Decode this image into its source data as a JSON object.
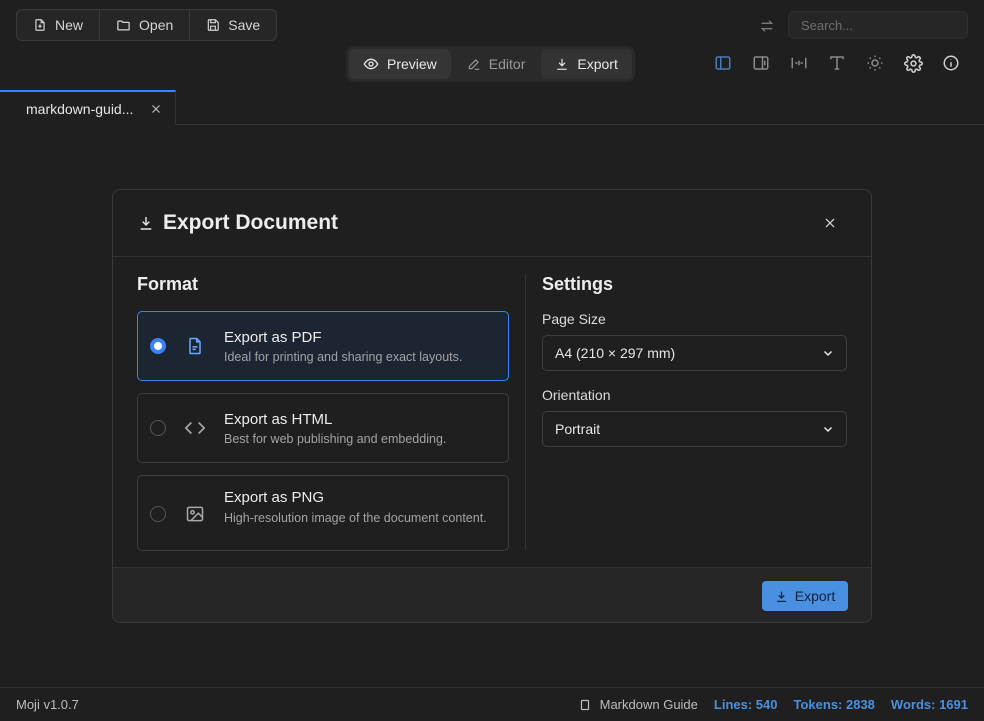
{
  "toolbar": {
    "new_label": "New",
    "open_label": "Open",
    "save_label": "Save",
    "search_placeholder": "Search...",
    "view_tabs": [
      {
        "label": "Preview",
        "icon": "eye-icon"
      },
      {
        "label": "Editor",
        "icon": "pencil-icon"
      },
      {
        "label": "Export",
        "icon": "download-icon"
      }
    ],
    "right_icons": [
      "sidebar-left-icon",
      "sidebar-right-icon",
      "split-width-icon",
      "typography-icon",
      "sun-icon",
      "gear-icon",
      "info-icon"
    ]
  },
  "file_tab": {
    "label": "markdown-guid..."
  },
  "modal": {
    "title": "Export Document",
    "format_heading": "Format",
    "settings_heading": "Settings",
    "options": [
      {
        "title": "Export as PDF",
        "desc": "Ideal for printing and sharing exact layouts.",
        "selected": true,
        "icon": "file-icon"
      },
      {
        "title": "Export as HTML",
        "desc": "Best for web publishing and embedding.",
        "selected": false,
        "icon": "code-icon"
      },
      {
        "title": "Export as PNG",
        "desc": "High-resolution image of the document content.",
        "selected": false,
        "icon": "image-icon"
      }
    ],
    "page_size_label": "Page Size",
    "page_size_value": "A4 (210 × 297 mm)",
    "orientation_label": "Orientation",
    "orientation_value": "Portrait",
    "export_button": "Export"
  },
  "status": {
    "version": "Moji v1.0.7",
    "doc_name": "Markdown Guide",
    "lines": "Lines: 540",
    "tokens": "Tokens: 2838",
    "words": "Words: 1691"
  },
  "colors": {
    "accent": "#3b82f6",
    "button": "#4a90e2",
    "background": "#1f1f1f"
  }
}
